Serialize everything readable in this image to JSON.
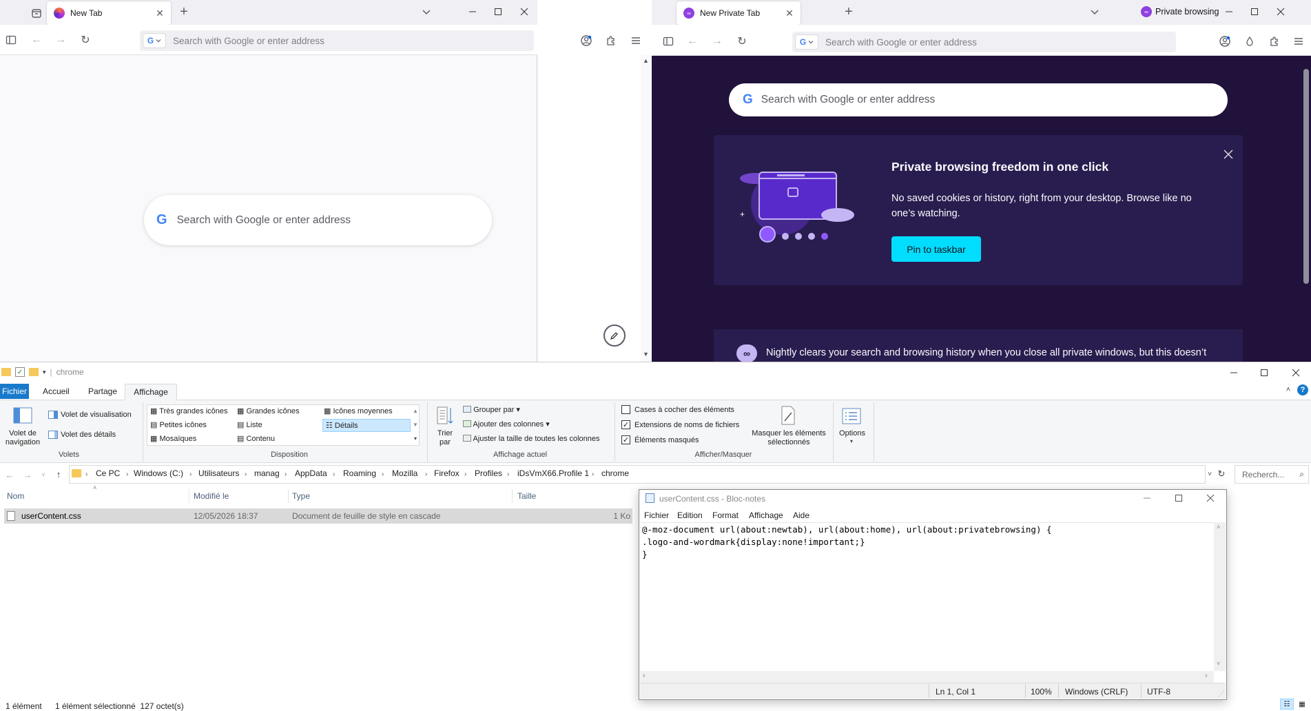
{
  "left_browser": {
    "tab_title": "New Tab",
    "address_placeholder": "Search with Google or enter address",
    "search_placeholder": "Search with Google or enter address"
  },
  "right_browser": {
    "tab_title": "New Private Tab",
    "private_label": "Private browsing",
    "address_placeholder": "Search with Google or enter address",
    "search_placeholder": "Search with Google or enter address",
    "promo": {
      "title": "Private browsing freedom in one click",
      "body": "No saved cookies or history, right from your desktop. Browse like no one’s watching.",
      "button": "Pin to taskbar"
    },
    "info_text": "Nightly clears your search and browsing history when you close all private windows, but this doesn’t"
  },
  "explorer": {
    "title": "chrome",
    "tabs": [
      "Fichier",
      "Accueil",
      "Partage",
      "Affichage"
    ],
    "ribbon": {
      "volet_navigation": "Volet de navigation",
      "volet_visualisation": "Volet de visualisation",
      "volet_details": "Volet des détails",
      "volets_group": "Volets",
      "layouts": [
        "Très grandes icônes",
        "Grandes icônes",
        "Icônes moyennes",
        "Petites icônes",
        "Liste",
        "Détails",
        "Mosaïques",
        "Contenu"
      ],
      "disposition_group": "Disposition",
      "trier_par": "Trier par",
      "grouper_par": "Grouper par",
      "ajouter_colonnes": "Ajouter des colonnes",
      "ajuster_colonnes": "Ajuster la taille de toutes les colonnes",
      "affichage_actuel_group": "Affichage actuel",
      "cases_cocher": "Cases à cocher des éléments",
      "extensions": "Extensions de noms de fichiers",
      "elements_masques": "Éléments masqués",
      "masquer_elements": "Masquer les éléments sélectionnés",
      "afficher_masquer_group": "Afficher/Masquer",
      "options": "Options",
      "checkboxes": {
        "cases_cocher": false,
        "extensions": true,
        "elements_masques": true
      }
    },
    "breadcrumb": [
      "Ce PC",
      "Windows (C:)",
      "Utilisateurs",
      "manag",
      "AppData",
      "Roaming",
      "Mozilla",
      "Firefox",
      "Profiles",
      "iDsVmX66.Profile 1",
      "chrome"
    ],
    "search_placeholder": "Recherch...",
    "columns": [
      "Nom",
      "Modifié le",
      "Type",
      "Taille"
    ],
    "files": [
      {
        "name": "userContent.css",
        "modified": "12/05/2026 18:37",
        "type": "Document de feuille de style en cascade",
        "size": "1 Ko"
      }
    ],
    "status": {
      "count": "1 élément",
      "selected": "1 élément sélectionné  127 octet(s)"
    }
  },
  "notepad": {
    "title": "userContent.css - Bloc-notes",
    "menu": [
      "Fichier",
      "Edition",
      "Format",
      "Affichage",
      "Aide"
    ],
    "lines": [
      "@-moz-document url(about:newtab), url(about:home), url(about:privatebrowsing) {",
      ".logo-and-wordmark{display:none!important;}",
      "}"
    ],
    "status": {
      "position": "Ln 1, Col 1",
      "zoom": "100%",
      "line_endings": "Windows (CRLF)",
      "encoding": "UTF-8"
    }
  },
  "colors": {
    "private_bg": "#20123a",
    "private_card": "#291d4f",
    "pin_button": "#00ddff",
    "selection_blue": "#cce8ff",
    "explorer_tab_blue": "#1979ca"
  }
}
